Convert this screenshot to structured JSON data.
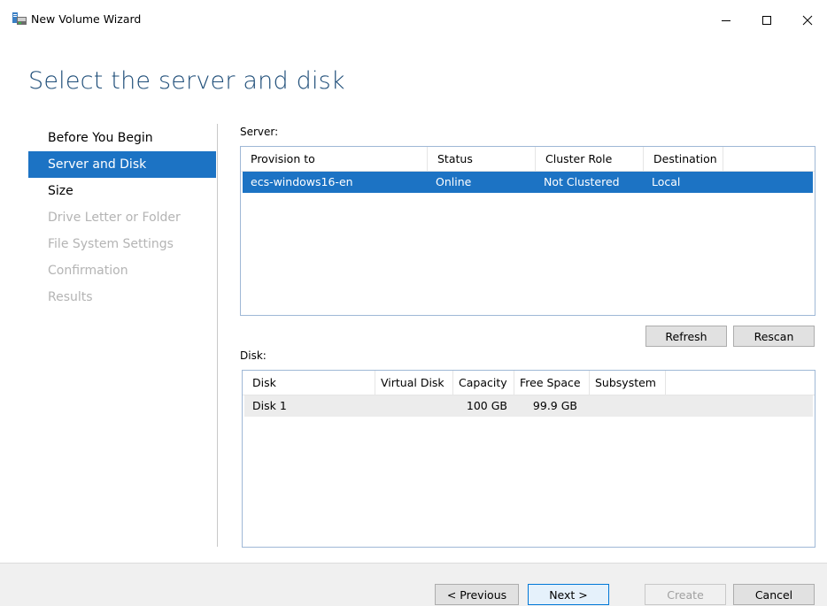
{
  "window": {
    "title": "New Volume Wizard",
    "icon": "server-volume-icon"
  },
  "page_title": "Select the server and disk",
  "nav": {
    "items": [
      {
        "label": "Before You Begin",
        "state": "normal"
      },
      {
        "label": "Server and Disk",
        "state": "active"
      },
      {
        "label": "Size",
        "state": "normal"
      },
      {
        "label": "Drive Letter or Folder",
        "state": "disabled"
      },
      {
        "label": "File System Settings",
        "state": "disabled"
      },
      {
        "label": "Confirmation",
        "state": "disabled"
      },
      {
        "label": "Results",
        "state": "disabled"
      }
    ]
  },
  "server": {
    "label": "Server:",
    "columns": [
      "Provision to",
      "Status",
      "Cluster Role",
      "Destination"
    ],
    "rows": [
      {
        "provision_to": "ecs-windows16-en",
        "status": "Online",
        "cluster_role": "Not Clustered",
        "destination": "Local",
        "selected": true
      }
    ],
    "refresh_label": "Refresh",
    "rescan_label": "Rescan"
  },
  "disk": {
    "label": "Disk:",
    "columns": [
      "Disk",
      "Virtual Disk",
      "Capacity",
      "Free Space",
      "Subsystem"
    ],
    "rows": [
      {
        "disk": "Disk 1",
        "virtual_disk": "",
        "capacity": "100 GB",
        "free_space": "99.9 GB",
        "subsystem": ""
      }
    ]
  },
  "footer": {
    "previous_label": "< Previous",
    "next_label": "Next >",
    "create_label": "Create",
    "cancel_label": "Cancel"
  },
  "colors": {
    "accent": "#1c73c4",
    "title": "#1f4e79",
    "disabled_text": "#b4b4b4"
  }
}
